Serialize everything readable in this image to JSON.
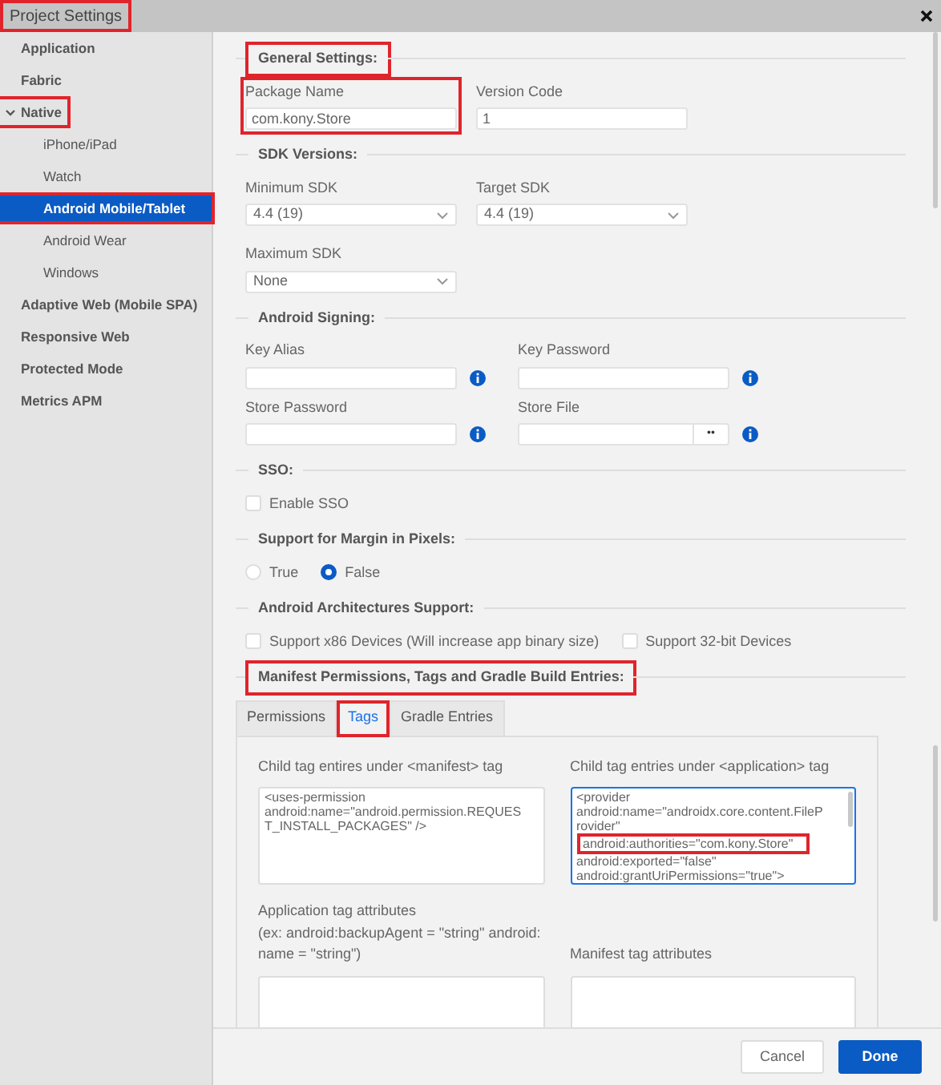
{
  "window": {
    "title": "Project Settings",
    "highlighted": true
  },
  "sidebar": {
    "items": [
      {
        "label": "Application",
        "selected": false,
        "highlighted": false
      },
      {
        "label": "Fabric",
        "selected": false,
        "highlighted": false
      },
      {
        "label": "Native",
        "selected": false,
        "highlighted": true,
        "expanded": true,
        "children": [
          {
            "label": "iPhone/iPad",
            "selected": false,
            "highlighted": false
          },
          {
            "label": "Watch",
            "selected": false,
            "highlighted": false
          },
          {
            "label": "Android Mobile/Tablet",
            "selected": true,
            "highlighted": true
          },
          {
            "label": "Android Wear",
            "selected": false,
            "highlighted": false
          },
          {
            "label": "Windows",
            "selected": false,
            "highlighted": false
          }
        ]
      },
      {
        "label": "Adaptive Web (Mobile SPA)",
        "selected": false,
        "highlighted": false
      },
      {
        "label": "Responsive Web",
        "selected": false,
        "highlighted": false
      },
      {
        "label": "Protected Mode",
        "selected": false,
        "highlighted": false
      },
      {
        "label": "Metrics APM",
        "selected": false,
        "highlighted": false
      }
    ]
  },
  "sections": [
    {
      "kind": "fields",
      "legend": "General Settings:",
      "highlighted": true,
      "fields": [
        {
          "kind": "text",
          "label": "Package Name",
          "value": "com.kony.Store",
          "highlighted": true,
          "info": false
        },
        {
          "kind": "text",
          "label": "Version Code",
          "value": "1",
          "highlighted": false,
          "info": false
        }
      ]
    },
    {
      "kind": "fields",
      "legend": "SDK Versions:",
      "highlighted": false,
      "fields": [
        {
          "kind": "select",
          "label": "Minimum SDK",
          "value": "4.4 (19)",
          "highlighted": false,
          "info": false
        },
        {
          "kind": "select",
          "label": "Target SDK",
          "value": "4.4 (19)",
          "highlighted": false,
          "info": false
        },
        {
          "kind": "select",
          "label": "Maximum SDK",
          "value": "None",
          "highlighted": false,
          "info": false
        }
      ]
    },
    {
      "kind": "fields",
      "legend": "Android Signing:",
      "highlighted": false,
      "fields": [
        {
          "kind": "text",
          "label": "Key Alias",
          "highlighted": false,
          "info": true
        },
        {
          "kind": "text",
          "label": "Key Password",
          "highlighted": false,
          "info": true
        },
        {
          "kind": "text",
          "label": "Store Password",
          "highlighted": false,
          "info": true
        },
        {
          "kind": "file",
          "label": "Store File",
          "browse": "••",
          "highlighted": false,
          "info": true
        }
      ]
    },
    {
      "kind": "checks",
      "legend": "SSO:",
      "highlighted": false,
      "options": [
        {
          "label": "Enable SSO",
          "checked": false
        }
      ]
    },
    {
      "kind": "radios",
      "legend": "Support for Margin in Pixels:",
      "highlighted": false,
      "options": [
        {
          "label": "True",
          "selected": false
        },
        {
          "label": "False",
          "selected": true
        }
      ]
    },
    {
      "kind": "checks",
      "legend": "Android Architectures Support:",
      "highlighted": false,
      "options": [
        {
          "label": "Support x86 Devices (Will increase app binary size)",
          "checked": false
        },
        {
          "label": "Support 32-bit Devices",
          "checked": false
        }
      ]
    },
    {
      "kind": "tabs",
      "legend": "Manifest Permissions, Tags and Gradle Build Entries:",
      "highlighted": true,
      "tabs": [
        {
          "label": "Permissions",
          "selected": false,
          "highlighted": false
        },
        {
          "label": "Tags",
          "selected": true,
          "highlighted": true
        },
        {
          "label": "Gradle Entries",
          "selected": false,
          "highlighted": false
        }
      ],
      "areas": [
        {
          "label": "Child tag entires under <manifest> tag",
          "focused": false,
          "lines": [
            {
              "text": "<uses-permission",
              "highlighted": false
            },
            {
              "text": "android:name=\"android.permission.REQUES",
              "highlighted": false
            },
            {
              "text": "T_INSTALL_PACKAGES\" />",
              "highlighted": false
            }
          ]
        },
        {
          "label": "Child tag entries under <application> tag",
          "focused": true,
          "lines": [
            {
              "text": "<provider",
              "highlighted": false
            },
            {
              "text": "android:name=\"androidx.core.content.FileP",
              "highlighted": false
            },
            {
              "text": "rovider\"",
              "highlighted": false
            },
            {
              "text": "android:authorities=\"com.kony.Store\"",
              "highlighted": true
            },
            {
              "text": "android:exported=\"false\"",
              "highlighted": false
            },
            {
              "text": "android:grantUriPermissions=\"true\">",
              "highlighted": false
            }
          ]
        },
        {
          "label": "Application tag attributes\n(ex: android:backupAgent = \"string\" android:\nname = \"string\")",
          "focused": false
        },
        {
          "label": "Manifest tag attributes",
          "focused": false
        }
      ]
    }
  ],
  "footer": {
    "buttons": [
      {
        "label": "Cancel",
        "kind": "secondary"
      },
      {
        "label": "Done",
        "kind": "primary"
      }
    ]
  }
}
